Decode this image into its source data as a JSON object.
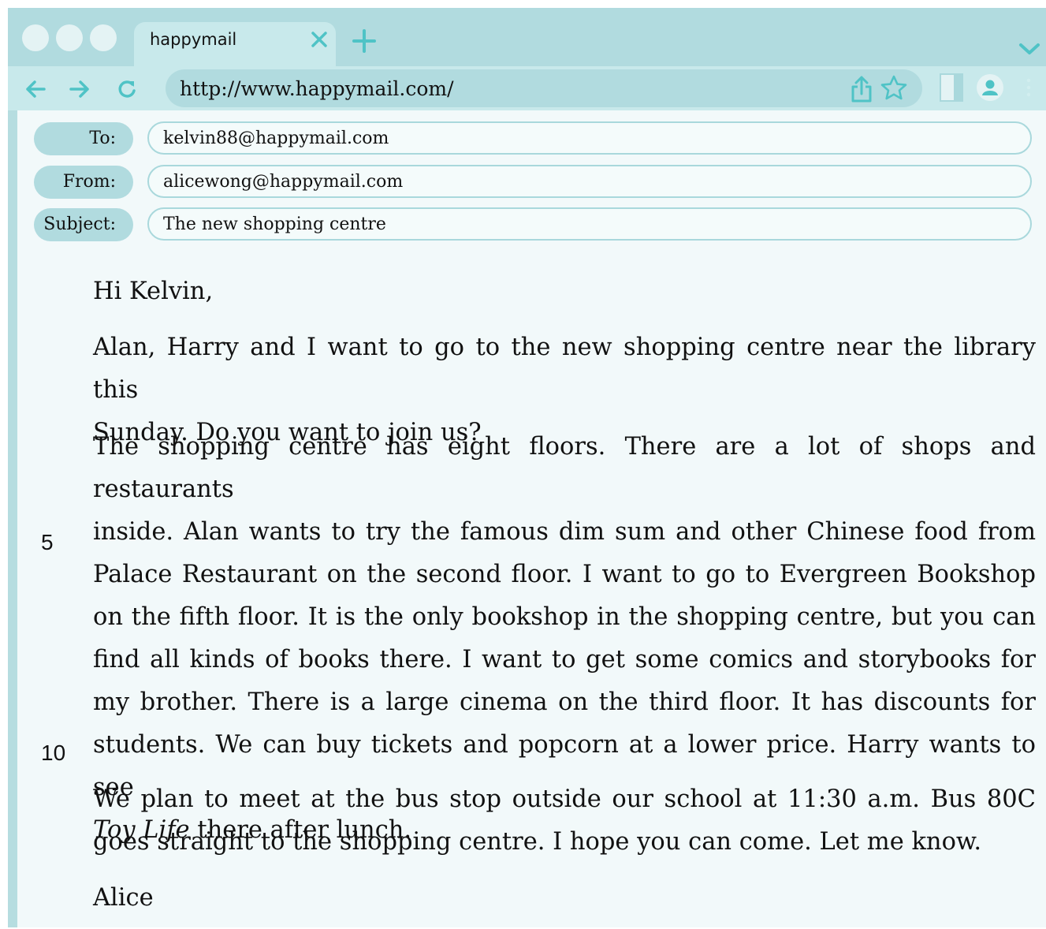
{
  "browser": {
    "tab_title": "happymail",
    "url": "http://www.happymail.com/"
  },
  "email": {
    "to_label": "To:",
    "to_value": "kelvin88@happymail.com",
    "from_label": "From:",
    "from_value": "alicewong@happymail.com",
    "subject_label": "Subject:",
    "subject_value": "The new shopping centre",
    "greeting": "Hi Kelvin,",
    "para1": [
      "Alan, Harry and I want to go to the new shopping centre near the library this",
      "Sunday. Do you want to join us?"
    ],
    "para2": [
      "The shopping centre has eight floors. There are a lot of shops and restaurants",
      "inside. Alan wants to try the famous dim sum and other Chinese food from",
      "Palace Restaurant on the second floor. I want to go to Evergreen Bookshop",
      "on the fifth floor. It is the only bookshop in the shopping centre, but you can",
      "find all kinds of books there. I want to get some comics and storybooks for",
      "my brother. There is a large cinema on the third floor. It has discounts for",
      "students. We can buy tickets and popcorn at a lower price. Harry wants to see"
    ],
    "para2_last_italic": "Toy Life",
    "para2_last_rest": " there after lunch.",
    "para3": [
      "We plan to meet at the bus stop outside our school at 11:30 a.m. Bus 80C",
      "goes straight to the shopping centre. I hope you can come. Let me know."
    ],
    "signature": "Alice",
    "line_number_5": "5",
    "line_number_10": "10"
  },
  "colors": {
    "frame": "#b1dbdf",
    "toolbar": "#c8e9eb",
    "accent_icon": "#4fc3c6",
    "content_bg": "#f2f9fa"
  }
}
